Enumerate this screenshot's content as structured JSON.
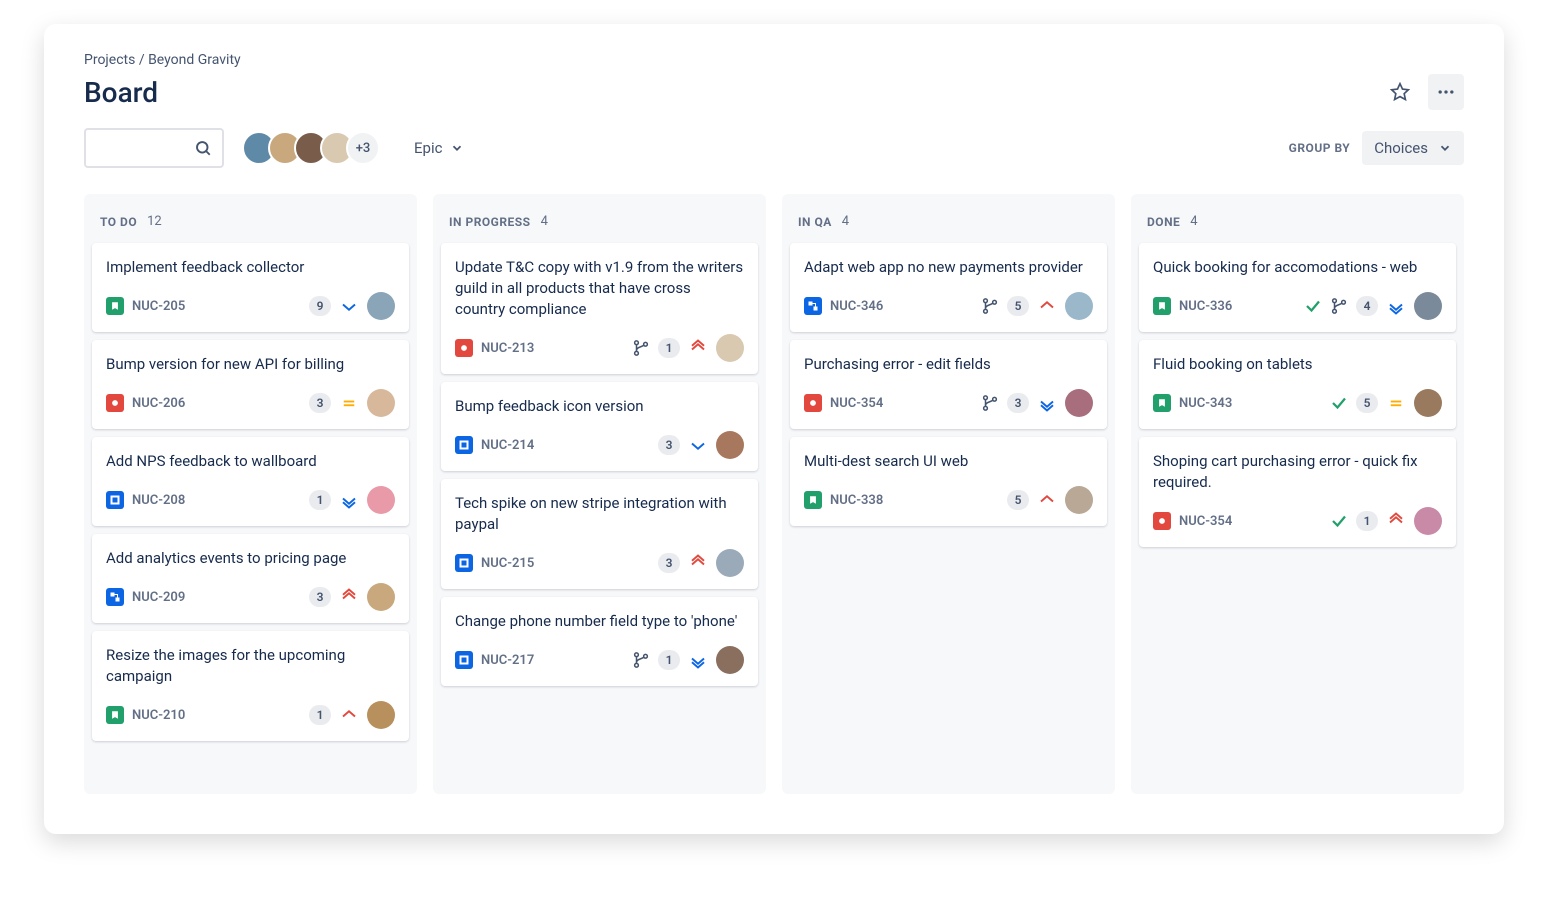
{
  "breadcrumb": {
    "root": "Projects",
    "project": "Beyond Gravity"
  },
  "page_title": "Board",
  "toolbar": {
    "avatar_overflow": "+3",
    "epic_label": "Epic",
    "group_by_label": "GROUP BY",
    "group_by_value": "Choices"
  },
  "avatar_colors": [
    "#5e8aa8",
    "#c9a87d",
    "#7a5c4a",
    "#d8c9b0"
  ],
  "columns": [
    {
      "title": "TO DO",
      "count": "12",
      "cards": [
        {
          "title": "Implement feedback collector",
          "type": "story",
          "key": "NUC-205",
          "points": "9",
          "priority": "low",
          "assignee": 0
        },
        {
          "title": "Bump version for new API for billing",
          "type": "bug",
          "key": "NUC-206",
          "points": "3",
          "priority": "medium",
          "assignee": 1
        },
        {
          "title": "Add NPS feedback to wallboard",
          "type": "task",
          "key": "NUC-208",
          "points": "1",
          "priority": "lowest",
          "assignee": 2
        },
        {
          "title": "Add analytics events to pricing page",
          "type": "subtask",
          "key": "NUC-209",
          "points": "3",
          "priority": "highest",
          "assignee": 3
        },
        {
          "title": "Resize the images for the upcoming campaign",
          "type": "story",
          "key": "NUC-210",
          "points": "1",
          "priority": "high",
          "assignee": 4
        }
      ]
    },
    {
      "title": "IN PROGRESS",
      "count": "4",
      "cards": [
        {
          "title": "Update T&C copy with v1.9 from the writers guild in all products that have cross country compliance",
          "type": "bug",
          "key": "NUC-213",
          "branch": true,
          "points": "1",
          "priority": "highest",
          "assignee": 5
        },
        {
          "title": "Bump feedback icon version",
          "type": "task",
          "key": "NUC-214",
          "points": "3",
          "priority": "low",
          "assignee": 6
        },
        {
          "title": "Tech spike on new stripe integration with paypal",
          "type": "task",
          "key": "NUC-215",
          "points": "3",
          "priority": "highest",
          "assignee": 7
        },
        {
          "title": "Change phone number field type to 'phone'",
          "type": "task",
          "key": "NUC-217",
          "branch": true,
          "points": "1",
          "priority": "lowest",
          "assignee": 8
        }
      ]
    },
    {
      "title": "IN QA",
      "count": "4",
      "cards": [
        {
          "title": "Adapt web app no new payments provider",
          "type": "subtask",
          "key": "NUC-346",
          "branch": true,
          "points": "5",
          "priority": "high",
          "assignee": 9
        },
        {
          "title": "Purchasing error - edit fields",
          "type": "bug",
          "key": "NUC-354",
          "branch": true,
          "points": "3",
          "priority": "lowest",
          "assignee": 10
        },
        {
          "title": "Multi-dest search UI web",
          "type": "story",
          "key": "NUC-338",
          "points": "5",
          "priority": "high",
          "assignee": 11
        }
      ]
    },
    {
      "title": "DONE",
      "count": "4",
      "cards": [
        {
          "title": "Quick booking for accomodations - web",
          "type": "story",
          "key": "NUC-336",
          "done": true,
          "branch": true,
          "points": "4",
          "priority": "lowest",
          "assignee": 12
        },
        {
          "title": "Fluid booking on tablets",
          "type": "story",
          "key": "NUC-343",
          "done": true,
          "points": "5",
          "priority": "medium",
          "assignee": 13
        },
        {
          "title": "Shoping cart purchasing error - quick fix required.",
          "type": "bug",
          "key": "NUC-354",
          "done": true,
          "points": "1",
          "priority": "highest",
          "assignee": 14
        }
      ]
    }
  ],
  "assignee_colors": [
    "#8aa4b8",
    "#d8b89a",
    "#e89aa8",
    "#c9a87d",
    "#b8905e",
    "#d8c9b0",
    "#a8785e",
    "#9aaab8",
    "#8a6e5e",
    "#9ab8c9",
    "#a86e7d",
    "#b8a895",
    "#7a8a9a",
    "#9a7a5e",
    "#c98aa8"
  ]
}
